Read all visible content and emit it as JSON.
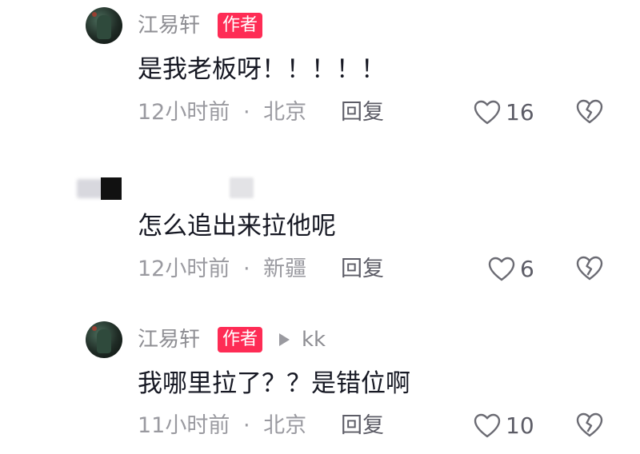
{
  "comments": [
    {
      "username": "江易轩",
      "author_badge": "作者",
      "content": "是我老板呀！！！！！",
      "time": "12小时前",
      "location": "北京",
      "reply_label": "回复",
      "likes": "16"
    },
    {
      "username": "",
      "content": "怎么追出来拉他呢",
      "time": "12小时前",
      "location": "新疆",
      "reply_label": "回复",
      "likes": "6"
    },
    {
      "username": "江易轩",
      "author_badge": "作者",
      "reply_to": "kk",
      "content": "我哪里拉了？？是错位啊",
      "time": "11小时前",
      "location": "北京",
      "reply_label": "回复",
      "likes": "10"
    }
  ],
  "separator": "·",
  "colors": {
    "author_badge_bg": "#fe2c55",
    "meta_text": "#9a9aa0",
    "content_text": "#161823"
  },
  "icons": [
    "heart-outline-icon",
    "broken-heart-icon",
    "reply-arrow-icon"
  ]
}
